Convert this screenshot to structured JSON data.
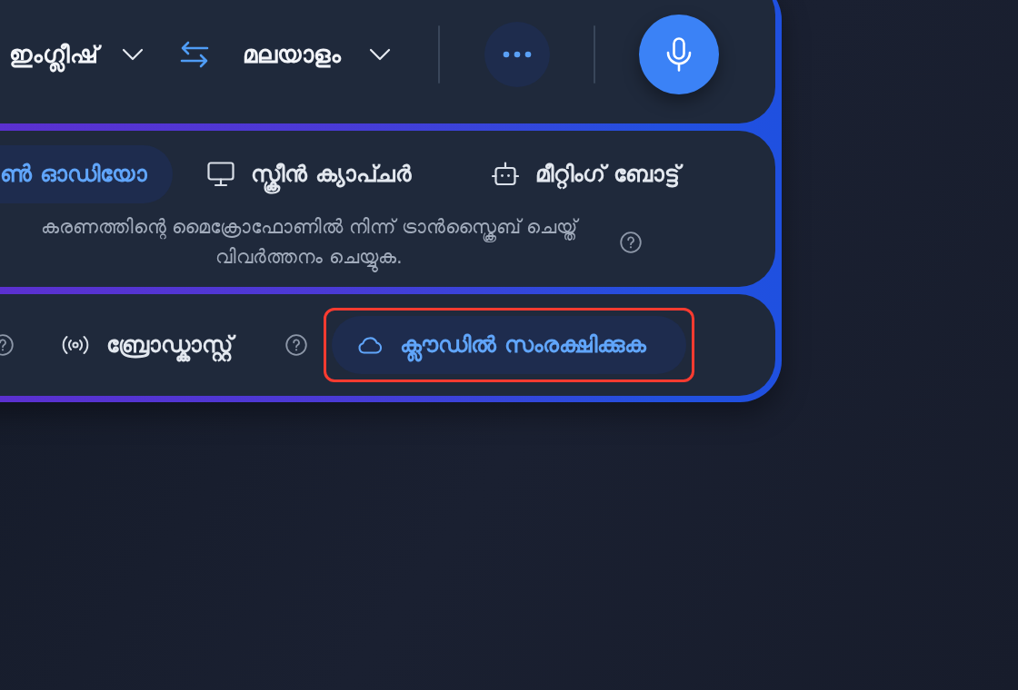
{
  "language_bar": {
    "source_language": {
      "label": "ഇംഗ്ലീഷ്"
    },
    "target_language": {
      "label": "മലയാളം"
    }
  },
  "modes": [
    {
      "kind": "audio",
      "label": "ൺ ഓഡിയോ",
      "selected": true
    },
    {
      "kind": "screen",
      "label": "സ്ക്രീൻ ക്യാപ്ചർ",
      "selected": false
    },
    {
      "kind": "bot",
      "label": "മീറ്റിംഗ് ബോട്ട്",
      "selected": false
    }
  ],
  "mode_description": "കരണത്തിന്റെ മൈക്രോഫോണിൽ നിന്ന് ട്രാൻസ്ക്രൈബ് ചെയ്ത് വിവർത്തനം ചെയ്യുക.",
  "options": [
    {
      "kind": "help"
    },
    {
      "kind": "broadcast",
      "label": "ബ്രോഡ്കാസ്റ്റ്"
    },
    {
      "kind": "help"
    },
    {
      "kind": "cloud",
      "label": "ക്ലൗഡിൽ സംരക്ഷിക്കുക",
      "highlighted": true
    }
  ]
}
